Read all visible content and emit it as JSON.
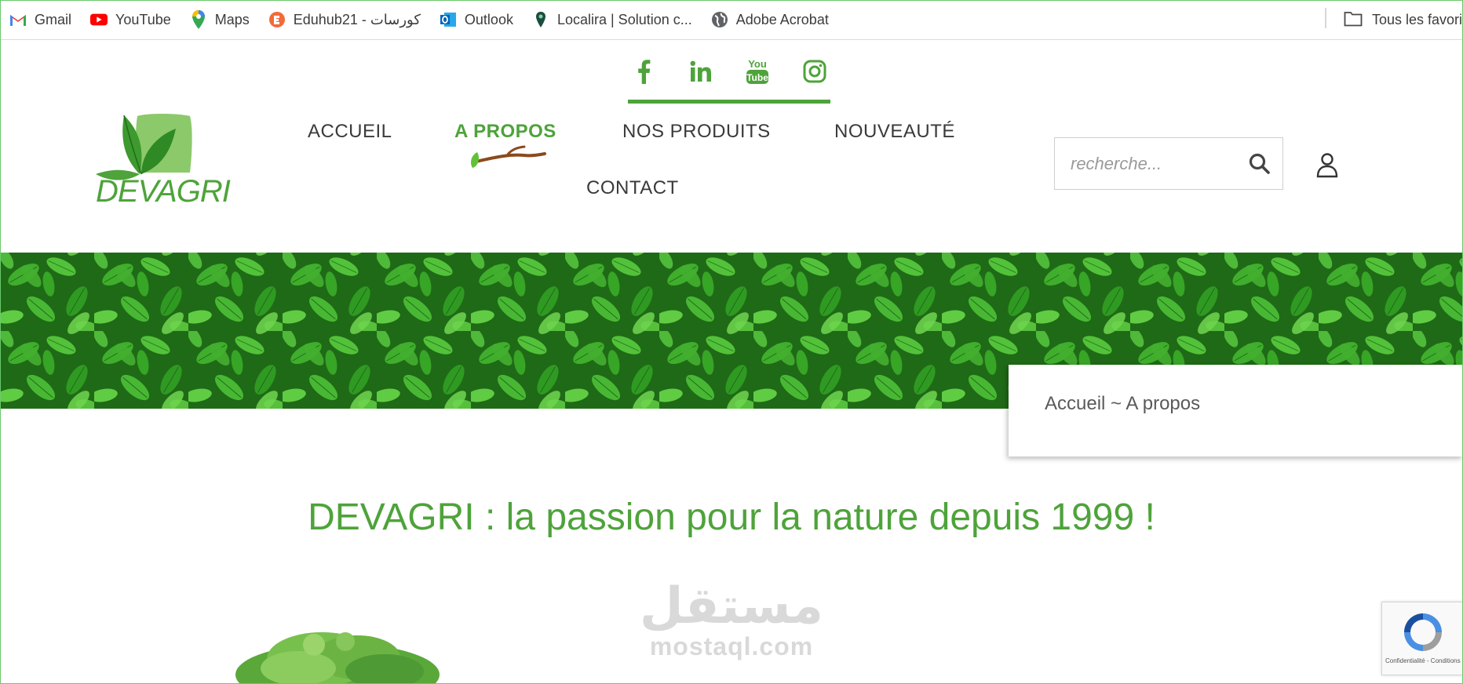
{
  "bookmarks": {
    "items": [
      {
        "label": "Gmail",
        "icon": "gmail-icon"
      },
      {
        "label": "YouTube",
        "icon": "youtube-icon"
      },
      {
        "label": "Maps",
        "icon": "maps-icon"
      },
      {
        "label": "Eduhub21 - كورسات",
        "icon": "eduhub-icon"
      },
      {
        "label": "Outlook",
        "icon": "outlook-icon"
      },
      {
        "label": "Localira | Solution c...",
        "icon": "localira-icon"
      },
      {
        "label": "Adobe Acrobat",
        "icon": "globe-icon"
      }
    ],
    "all_bookmarks": "Tous les favori"
  },
  "social": [
    "facebook-icon",
    "linkedin-icon",
    "youtube-icon",
    "instagram-icon"
  ],
  "logo": {
    "text": "DEVAGRI"
  },
  "nav": {
    "items": [
      "ACCUEIL",
      "A PROPOS",
      "NOS PRODUITS",
      "NOUVEAUTÉ",
      "CONTACT"
    ],
    "active": "A PROPOS"
  },
  "search": {
    "placeholder": "recherche..."
  },
  "breadcrumb": "Accueil ~ A propos",
  "heading": "DEVAGRI : la passion pour la nature depuis 1999 !",
  "watermark": {
    "arabic": "مستقل",
    "latin": "mostaql.com"
  },
  "recaptcha": {
    "text": "Confidentialité - Conditions"
  },
  "colors": {
    "brand_green": "#4ea33a",
    "nav_text": "#3a3a3a",
    "branch_brown": "#8b4a1c"
  }
}
